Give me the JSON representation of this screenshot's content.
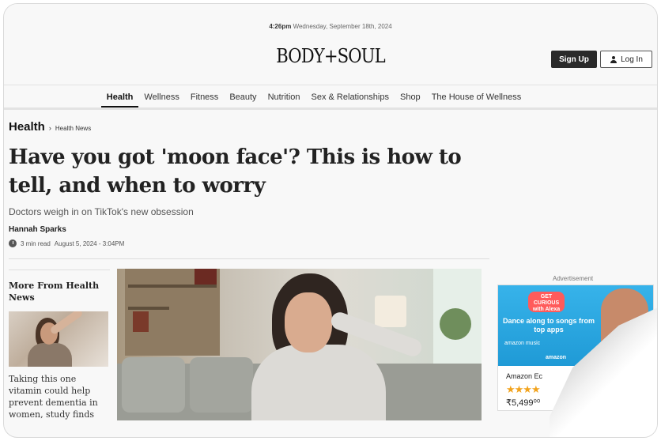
{
  "header": {
    "time": "4:26pm",
    "date": "Wednesday, September 18th, 2024",
    "logo_text": "BODY+SOUL",
    "signup_label": "Sign Up",
    "login_label": "Log In"
  },
  "nav": {
    "items": [
      "Health",
      "Wellness",
      "Fitness",
      "Beauty",
      "Nutrition",
      "Sex & Relationships",
      "Shop",
      "The House of Wellness"
    ],
    "active": "Health"
  },
  "article": {
    "section": "Health",
    "subsection": "Health News",
    "headline": "Have you got 'moon face'? This is how to tell, and when to worry",
    "standfirst": "Doctors weigh in on TikTok's new obsession",
    "author": "Hannah Sparks",
    "read_time": "3 min read",
    "published": "August 5, 2024 - 3:04PM"
  },
  "sidebar": {
    "title": "More From Health News",
    "story_text": "Taking this one vitamin could help prevent dementia in women, study finds"
  },
  "ad": {
    "label": "Advertisement",
    "badge": "GET CURIOUS with Alexa",
    "headline": "Dance along to songs from top apps",
    "brands": "amazon music",
    "brand2": "amazon",
    "product": "Amazon Ec",
    "stars": "★★★★",
    "price": "₹5,499⁰⁰"
  }
}
